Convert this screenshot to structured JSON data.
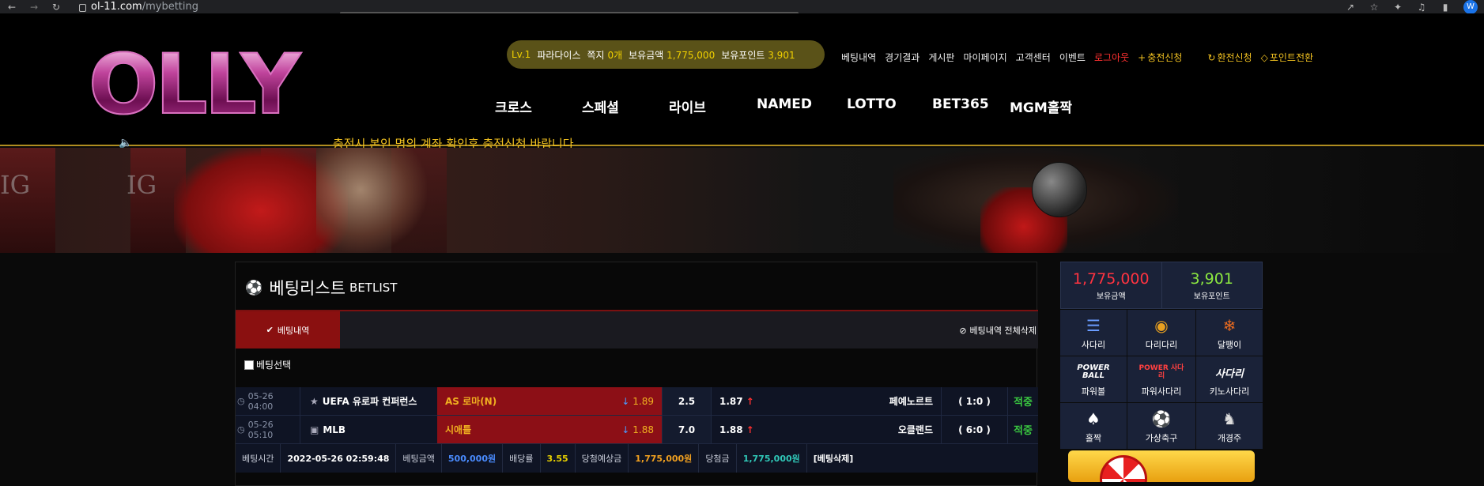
{
  "browser": {
    "url_host": "ol-11.com",
    "url_path": "/mybetting",
    "profile_initial": "W"
  },
  "header": {
    "logo_text": "OLLY",
    "notice": "충전시 본인 명의 계좌 확인후 충전신청 바랍니다",
    "user": {
      "level": "Lv.1",
      "nickname": "파라다이스",
      "messages_label": "쪽지",
      "messages_count": "0개",
      "money_label": "보유금액",
      "money_value": "1,775,000",
      "points_label": "보유포인트",
      "points_value": "3,901"
    },
    "top_links": {
      "bet_history": "베팅내역",
      "results": "경기결과",
      "board": "게시판",
      "mypage": "마이페이지",
      "support": "고객센터",
      "event": "이벤트",
      "logout": "로그아웃",
      "deposit": "충전신청",
      "withdraw": "환전신청",
      "point_convert": "포인트전환"
    },
    "nav": [
      "크로스",
      "스페셜",
      "라이브",
      "NAMED",
      "LOTTO",
      "BET365",
      "MGM홀짝"
    ]
  },
  "betlist": {
    "title_ko": "베팅리스트",
    "title_en": "BETLIST",
    "tab_history": "베팅내역",
    "delete_all": "베팅내역 전체삭제",
    "select_label": "베팅선택",
    "rows": [
      {
        "time": "05-26 04:00",
        "league": "UEFA 유로파 컨퍼런스",
        "home": "AS 로마(N)",
        "home_odds": "1.89",
        "draw": "2.5",
        "away_odds": "1.87",
        "away": "페예노르트",
        "score": "( 1:0 )",
        "result": "적중"
      },
      {
        "time": "05-26 05:10",
        "league": "MLB",
        "home": "시애틀",
        "home_odds": "1.88",
        "draw": "7.0",
        "away_odds": "1.88",
        "away": "오클랜드",
        "score": "( 6:0 )",
        "result": "적중"
      }
    ],
    "summary": {
      "bet_time_label": "베팅시간",
      "bet_time": "2022-05-26 02:59:48",
      "bet_amount_label": "베팅금액",
      "bet_amount": "500,000원",
      "odds_label": "배당률",
      "odds": "3.55",
      "expected_label": "당첨예상금",
      "expected": "1,775,000원",
      "win_label": "당첨금",
      "win": "1,775,000원",
      "delete_label": "[베팅삭제]"
    }
  },
  "side": {
    "money_value": "1,775,000",
    "money_label": "보유금액",
    "points_value": "3,901",
    "points_label": "보유포인트",
    "games": [
      "사다리",
      "다리다리",
      "달팽이",
      "파워볼",
      "파워사다리",
      "키노사다리",
      "홀짝",
      "가상축구",
      "개경주"
    ],
    "powerball_logo": "POWER BALL",
    "power_ladder_logo": "POWER 사다리",
    "keno_logo": "사다리"
  }
}
